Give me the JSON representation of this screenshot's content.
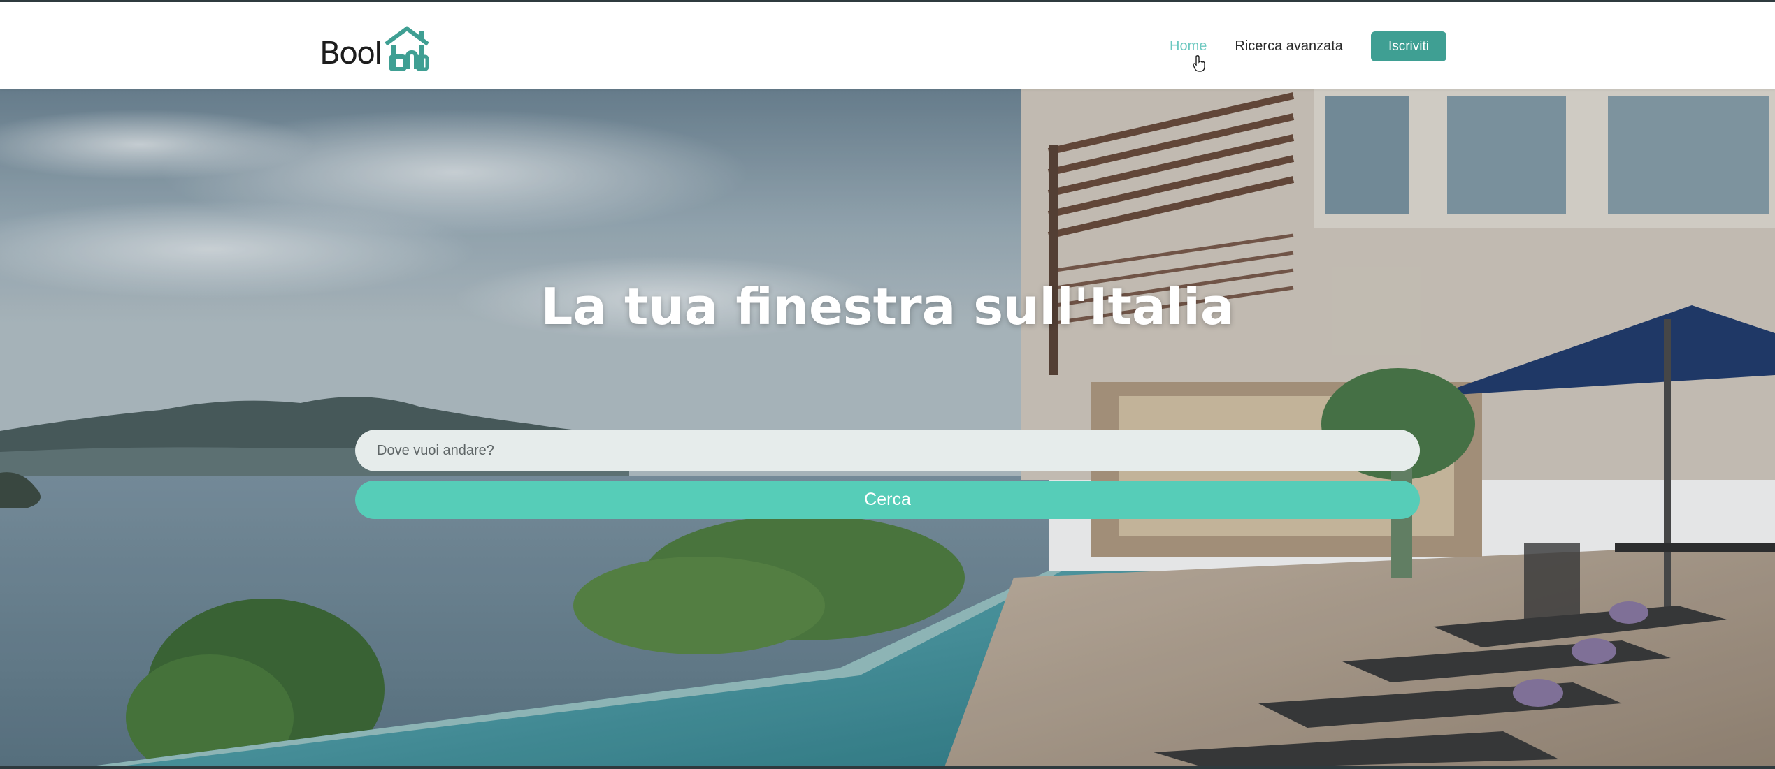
{
  "brand": {
    "logo_text": "Bool",
    "logo_icon": "house-bnb-icon",
    "accent_color": "#3f9f93"
  },
  "nav": {
    "home": "Home",
    "advanced_search": "Ricerca avanzata",
    "signup": "Iscriviti"
  },
  "hero": {
    "title": "La tua finestra sull'Italia",
    "search_placeholder": "Dove vuoi andare?",
    "search_button": "Cerca"
  },
  "colors": {
    "nav_active": "#6cc8c0",
    "search_button": "#56cdb8",
    "input_bg": "#e6eceb"
  }
}
